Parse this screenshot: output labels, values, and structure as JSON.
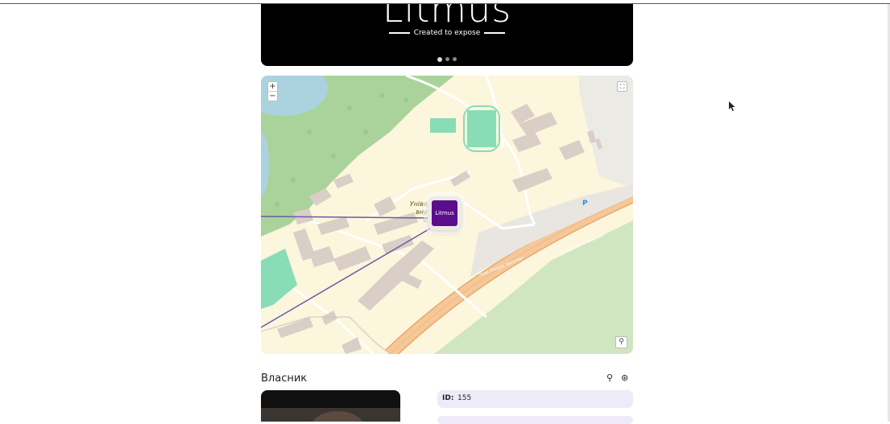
{
  "banner": {
    "logo": "Litmus",
    "tagline": "Created to expose",
    "slides": 3,
    "active_slide": 0
  },
  "map": {
    "zoom_in": "+",
    "zoom_out": "−",
    "university_label_line1": "Університ",
    "university_label_line2": "внутріш",
    "university_label_line3": "справ",
    "marker_label": "Litmus",
    "parking_label": "P",
    "road_label": "Льва Ландау проспект"
  },
  "owner": {
    "title": "Власник",
    "id_label": "ID:",
    "id_value": "155"
  },
  "colors": {
    "brand": "#5b0e8c",
    "accent_bg": "#eeeaf8",
    "road": "#f6c897",
    "grass": "#cfe6c0",
    "forest": "#a9d39a",
    "pitch": "#88dcb6"
  }
}
